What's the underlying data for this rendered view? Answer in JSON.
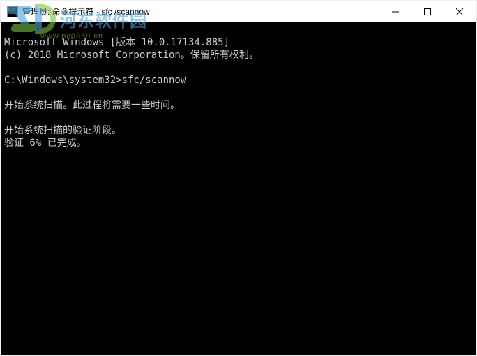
{
  "titlebar": {
    "title": "管理员: 命令提示符 - sfc /scannow"
  },
  "console": {
    "line1": "Microsoft Windows [版本 10.0.17134.885]",
    "line2": "(c) 2018 Microsoft Corporation。保留所有权利。",
    "line3": "",
    "prompt": "C:\\Windows\\system32>",
    "command": "sfc/scannow",
    "line5": "",
    "line6": "开始系统扫描。此过程将需要一些时间。",
    "line7": "",
    "line8": "开始系统扫描的验证阶段。",
    "line9": "验证 6% 已完成。"
  },
  "watermark": {
    "text": "河东软件园",
    "domain": "www.pc0359.cn"
  }
}
